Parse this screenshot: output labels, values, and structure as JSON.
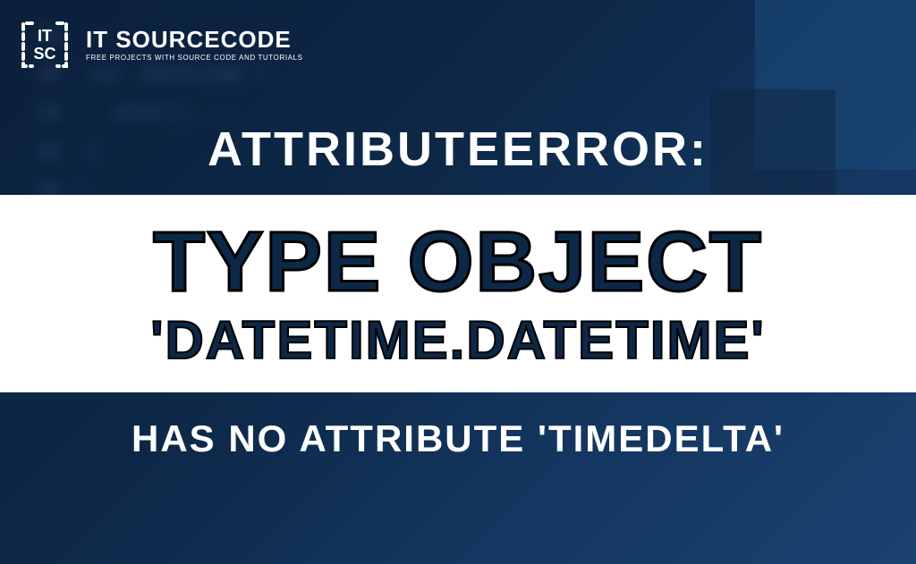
{
  "logo": {
    "title": "IT SOURCECODE",
    "tagline": "FREE PROJECTS WITH SOURCE CODE AND TUTORIALS"
  },
  "heading_top": "ATTRIBUTEERROR:",
  "band": {
    "line1": "TYPE OBJECT",
    "line2": "'DATETIME.DATETIME'"
  },
  "heading_bottom": "HAS NO ATTRIBUTE 'TIMEDELTA'",
  "background_code": "29\n30  var datetime = ...\n34    alert( ...\n35  }\n36 )\n37 }\n38  var marker = new Logic.secure.Attr..."
}
